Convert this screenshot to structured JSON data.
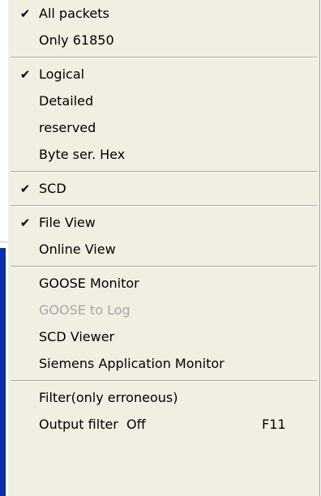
{
  "menu": {
    "items": [
      {
        "label": "All packets",
        "checked": true
      },
      {
        "label": "Only 61850",
        "checked": false
      },
      {
        "label": "Logical",
        "checked": true
      },
      {
        "label": "Detailed",
        "checked": false
      },
      {
        "label": "reserved",
        "checked": false
      },
      {
        "label": "Byte ser. Hex",
        "checked": false
      },
      {
        "label": "SCD",
        "checked": true
      },
      {
        "label": "File View",
        "checked": true
      },
      {
        "label": "Online View",
        "checked": false
      },
      {
        "label": "GOOSE Monitor",
        "checked": false
      },
      {
        "label": "GOOSE to Log",
        "checked": false,
        "disabled": true
      },
      {
        "label": "SCD Viewer",
        "checked": false
      },
      {
        "label": "Siemens Application Monitor",
        "checked": false
      },
      {
        "label": "Filter(only erroneous)",
        "checked": false
      },
      {
        "label": "Output filter  Off",
        "checked": false,
        "shortcut": "F11"
      }
    ],
    "check_glyph": "✔",
    "colors": {
      "menu_background": "#f1efe2",
      "disabled_text": "#a6a6a6",
      "background_stripe": "#0b2fa6"
    }
  }
}
